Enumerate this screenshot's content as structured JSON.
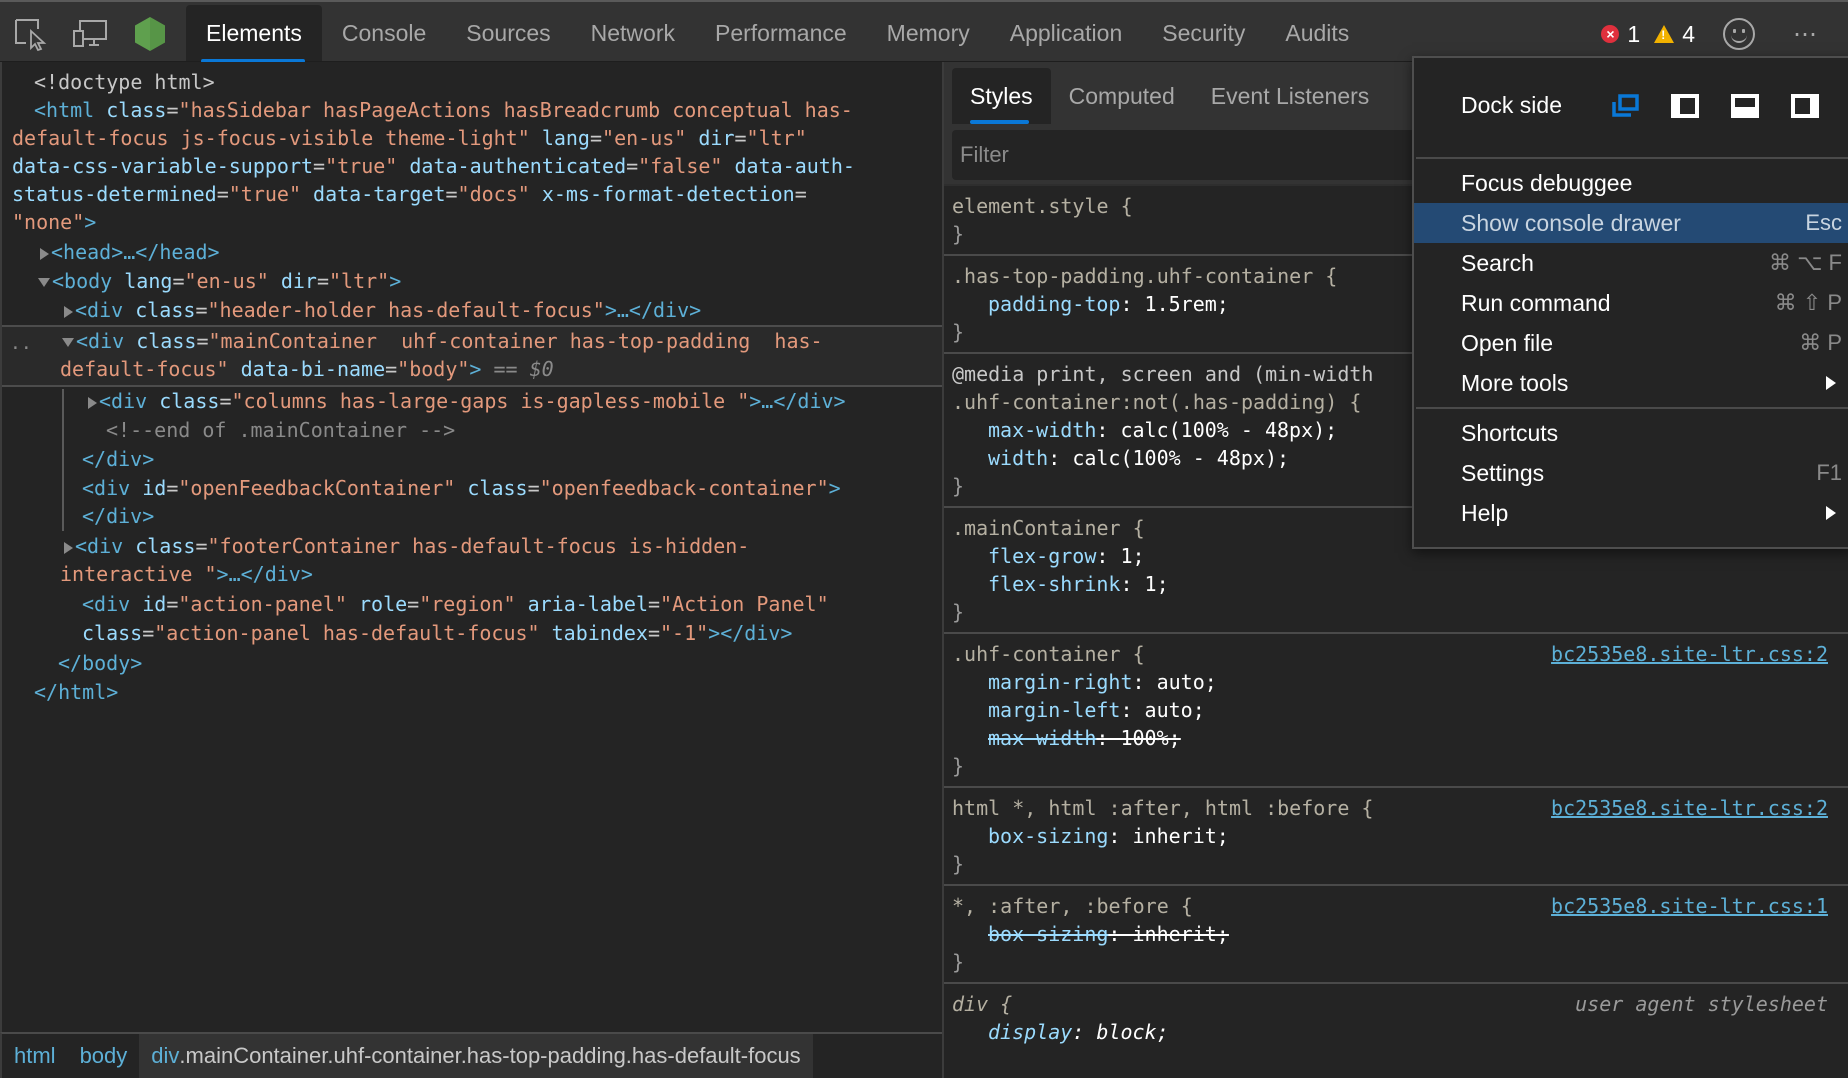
{
  "toolbar": {
    "icons": [
      "inspect-element-icon",
      "device-emulation-icon",
      "nodejs-icon"
    ],
    "tabs": [
      "Elements",
      "Console",
      "Sources",
      "Network",
      "Performance",
      "Memory",
      "Application",
      "Security",
      "Audits"
    ],
    "active_tab": "Elements",
    "error_count": "1",
    "warning_count": "4",
    "error_glyph": "×",
    "warning_glyph": "!",
    "more_glyph": "⋯"
  },
  "elements": {
    "lines": {
      "doctype": "<!doctype html>",
      "html_open_tag": "<html",
      "html_class_attr": "class",
      "html_class_val": "\"hasSidebar hasPageActions hasBreadcrumb conceptual has-",
      "html_class_val2": "default-focus js-focus-visible theme-light\"",
      "html_lang_attr": "lang",
      "html_lang_val": "\"en-us\"",
      "html_dir_attr": "dir",
      "html_dir_val": "\"ltr\"",
      "html_cssvar_attr": "data-css-variable-support",
      "html_cssvar_val": "\"true\"",
      "html_auth_attr": "data-authenticated",
      "html_auth_val": "\"false\"",
      "html_authstatus_attr1": "data-auth-",
      "html_authstatus_attr2": "status-determined",
      "html_authstatus_val": "\"true\"",
      "html_target_attr": "data-target",
      "html_target_val": "\"docs\"",
      "html_msformat_attr": "x-ms-format-detection",
      "html_msformat_val": "\"none\"",
      "head": "<head>…</head>",
      "body_open_tag": "<body",
      "body_lang_attr": "lang",
      "body_lang_val": "\"en-us\"",
      "body_dir_attr": "dir",
      "body_dir_val": "\"ltr\"",
      "header_tag": "<div",
      "header_class_attr": "class",
      "header_class_val": "\"header-holder has-default-focus\"",
      "header_close": ">…</div>",
      "main_tag": "<div",
      "main_class_attr": "class",
      "main_class_val1": "\"mainContainer  uhf-container has-top-padding  has-",
      "main_class_val2": "default-focus\"",
      "main_bi_attr": "data-bi-name",
      "main_bi_val": "\"body\"",
      "main_marker": " == $0",
      "columns_tag": "<div",
      "columns_class_attr": "class",
      "columns_class_val": "\"columns has-large-gaps is-gapless-mobile \"",
      "columns_close": ">…</div>",
      "comment": "<!--end of .mainContainer -->",
      "div_close": "</div>",
      "feedback_tag": "<div",
      "feedback_id_attr": "id",
      "feedback_id_val": "\"openFeedbackContainer\"",
      "feedback_class_attr": "class",
      "feedback_class_val": "\"openfeedback-container\"",
      "feedback_close": "</div>",
      "footer_tag": "<div",
      "footer_class_attr": "class",
      "footer_class_val1": "\"footerContainer has-default-focus is-hidden-",
      "footer_class_val2": "interactive \"",
      "footer_close": ">…</div>",
      "action_tag": "<div",
      "action_id_attr": "id",
      "action_id_val": "\"action-panel\"",
      "action_role_attr": "role",
      "action_role_val": "\"region\"",
      "action_aria_attr": "aria-label",
      "action_aria_val": "\"Action Panel\"",
      "action_class_attr": "class",
      "action_class_val": "\"action-panel has-default-focus\"",
      "action_tabindex_attr": "tabindex",
      "action_tabindex_val": "\"-1\"",
      "action_close": "></div>",
      "body_close": "</body>",
      "html_close": "</html>",
      "gutter_dots": ".."
    },
    "breadcrumb": {
      "items": [
        "html",
        "body"
      ],
      "active_tag": "div",
      "active_rest": ".mainContainer.uhf-container.has-top-padding.has-default-focus"
    }
  },
  "styles": {
    "tabs": [
      "Styles",
      "Computed",
      "Event Listeners"
    ],
    "active_tab": "Styles",
    "filter_placeholder": "Filter",
    "rules": [
      {
        "selector": "element.style {",
        "decls": []
      },
      {
        "selector": ".has-top-padding.uhf-container {",
        "decls": [
          {
            "prop": "padding-top",
            "value": "1.5rem;"
          }
        ]
      },
      {
        "media": "@media print, screen and (min-width",
        "selector": ".uhf-container:not(.has-padding) {",
        "decls": [
          {
            "prop": "max-width",
            "value": "calc(100% - 48px);"
          },
          {
            "prop": "width",
            "value": "calc(100% - 48px);"
          }
        ]
      },
      {
        "selector": ".mainContainer {",
        "decls": [
          {
            "prop": "flex-grow",
            "value": "1;"
          },
          {
            "prop": "flex-shrink",
            "value": "1;"
          }
        ]
      },
      {
        "selector": ".uhf-container {",
        "source": "bc2535e8.site-ltr.css:2",
        "decls": [
          {
            "prop": "margin-right",
            "value": "auto;"
          },
          {
            "prop": "margin-left",
            "value": "auto;"
          },
          {
            "prop": "max-width",
            "value": "100%;",
            "overridden": true
          }
        ]
      },
      {
        "selector": "html *, html :after, html :before {",
        "source": "bc2535e8.site-ltr.css:2",
        "decls": [
          {
            "prop": "box-sizing",
            "value": "inherit;"
          }
        ]
      },
      {
        "selector": "*, :after, :before {",
        "source": "bc2535e8.site-ltr.css:1",
        "decls": [
          {
            "prop": "box-sizing",
            "value": "inherit;",
            "overridden": true
          }
        ]
      },
      {
        "selector": "div {",
        "source": "user agent stylesheet",
        "decls": [
          {
            "prop": "display",
            "value": "block;"
          }
        ]
      }
    ],
    "close_brace": "}"
  },
  "menu": {
    "dock_side_label": "Dock side",
    "dock_options": [
      "undock-icon",
      "dock-left-icon",
      "dock-bottom-icon",
      "dock-right-icon"
    ],
    "dock_selected": "undock-icon",
    "items": [
      {
        "label": "Focus debuggee",
        "shortcut": ""
      },
      {
        "label": "Show console drawer",
        "shortcut": "Esc",
        "highlighted": true
      },
      {
        "label": "Search",
        "shortcut": "⌘ ⌥ F"
      },
      {
        "label": "Run command",
        "shortcut": "⌘ ⇧ P"
      },
      {
        "label": "Open file",
        "shortcut": "⌘ P"
      },
      {
        "label": "More tools",
        "submenu": true
      }
    ],
    "items2": [
      {
        "label": "Shortcuts",
        "shortcut": ""
      },
      {
        "label": "Settings",
        "shortcut": "F1"
      },
      {
        "label": "Help",
        "submenu": true
      }
    ]
  },
  "colors": {
    "accent": "#0a78d7",
    "menu_highlight": "#244a74",
    "tag": "#5db0d7",
    "attr_name": "#9bdbfe",
    "attr_value": "#e3997c",
    "error": "#e0303d",
    "warning": "#f2b200",
    "node_green": "#5fa04e"
  }
}
